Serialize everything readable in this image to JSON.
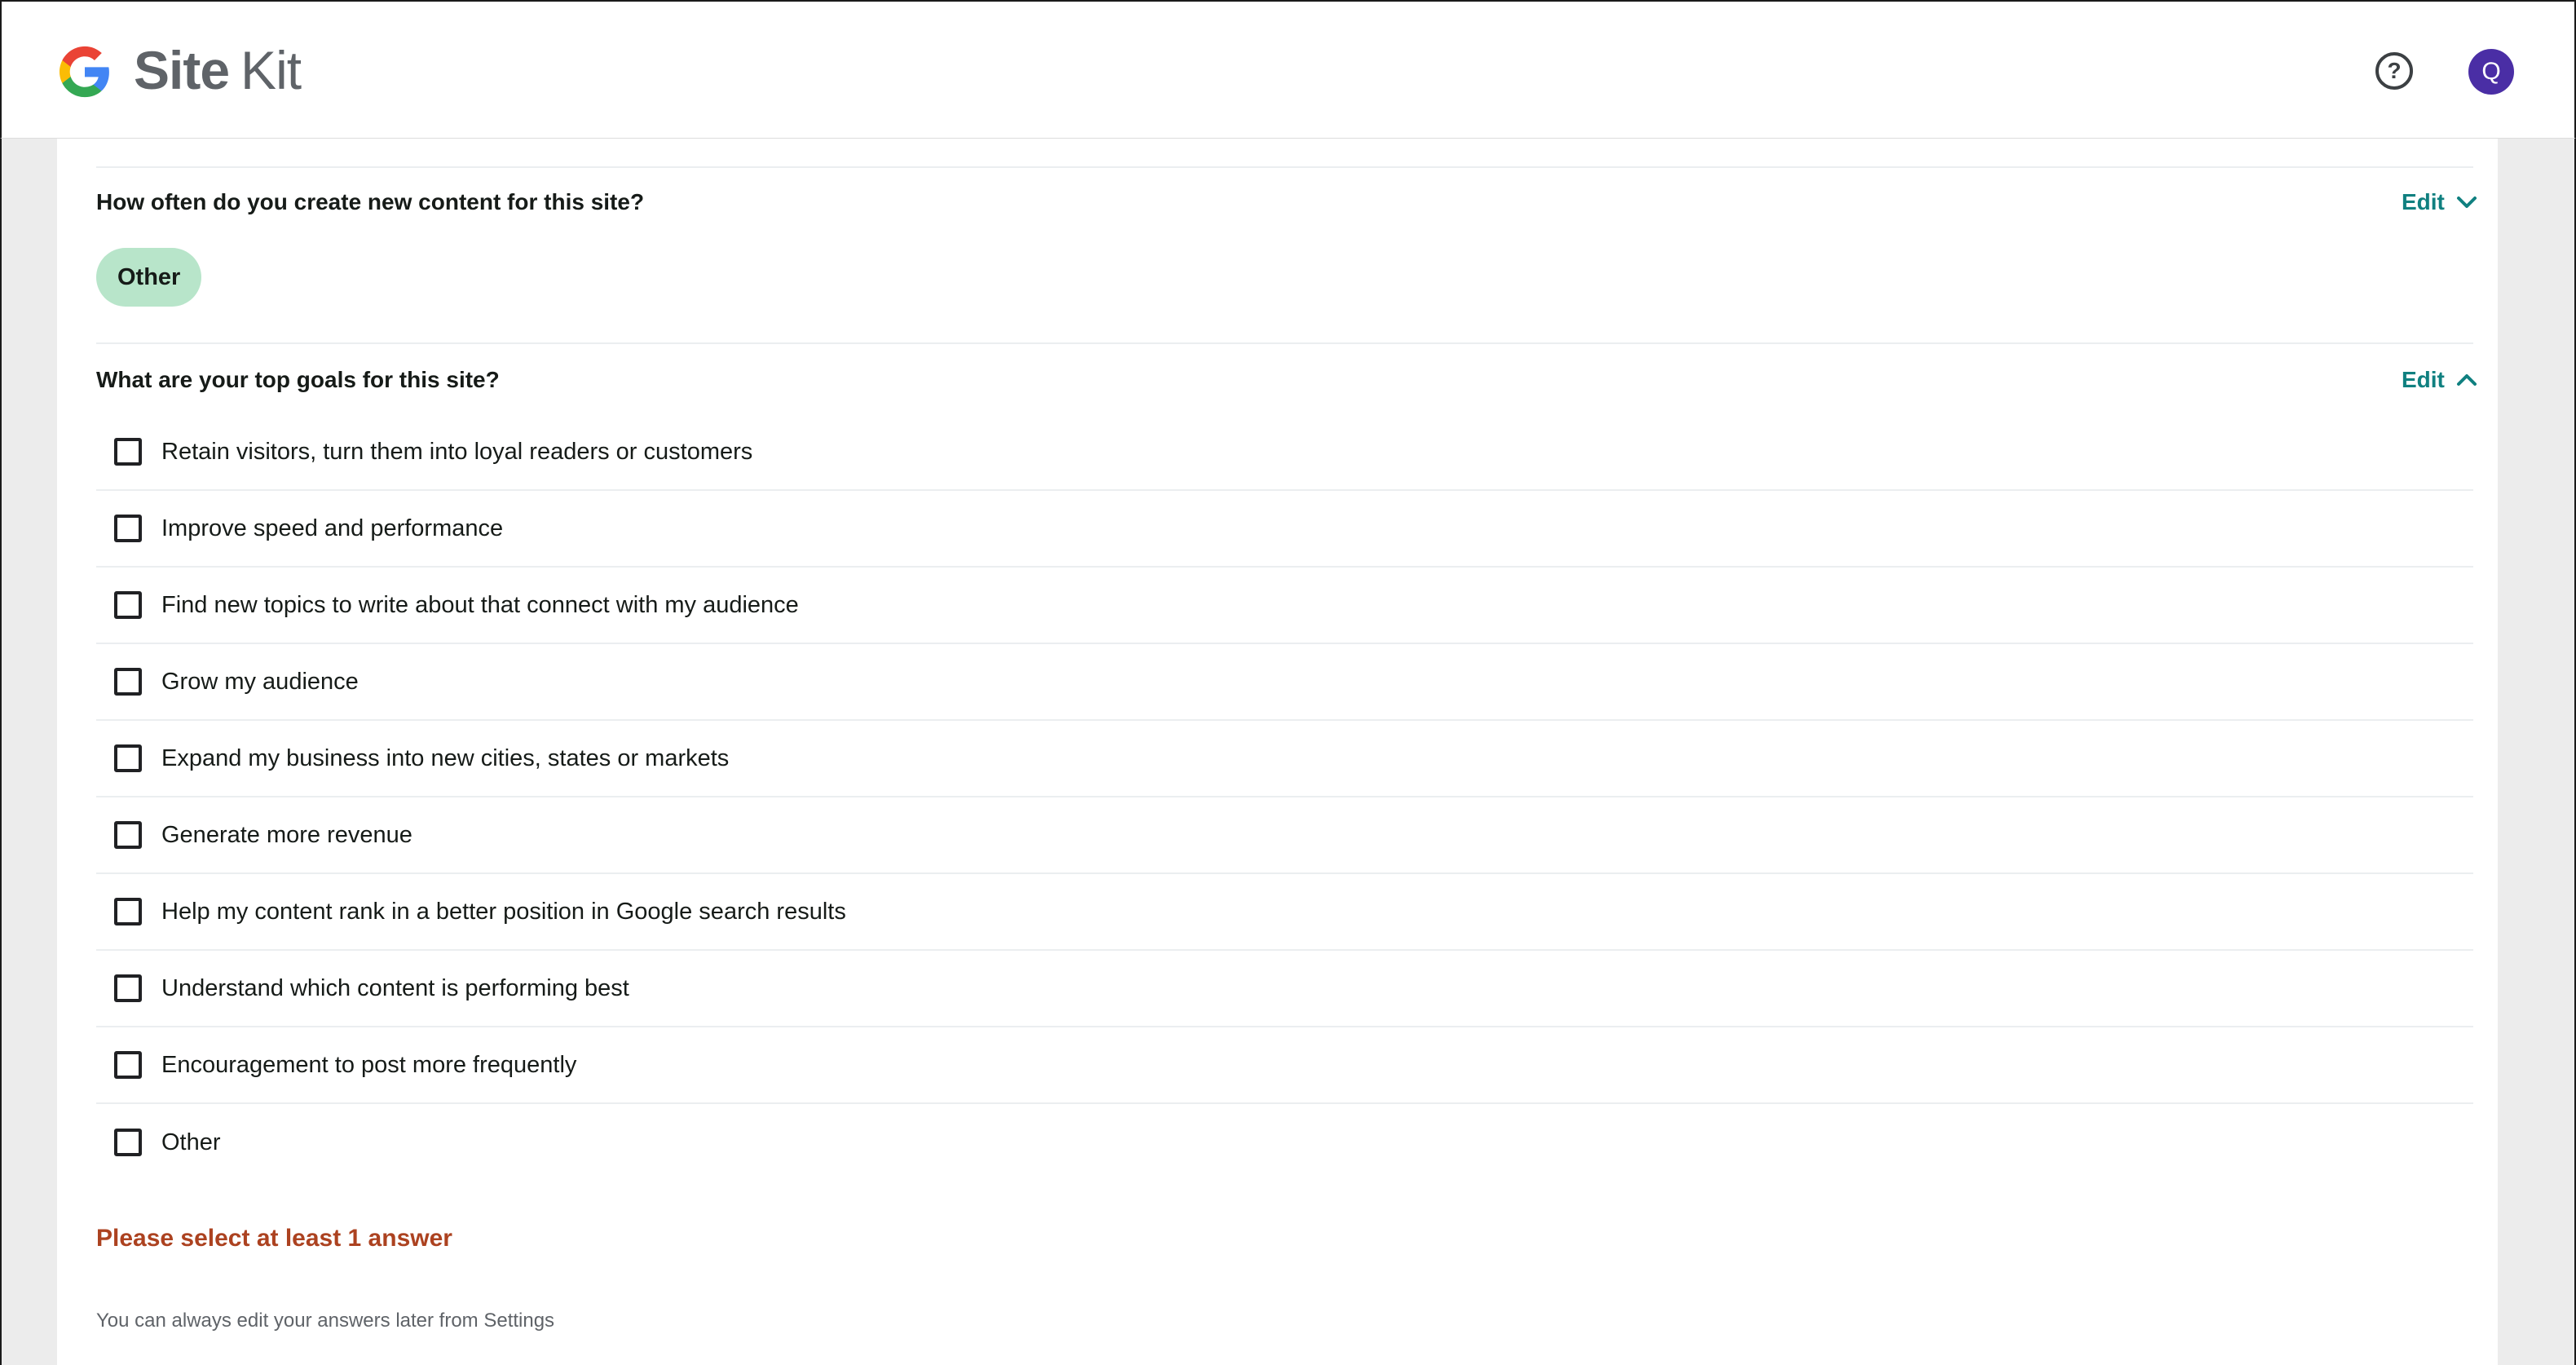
{
  "header": {
    "brand_site": "Site",
    "brand_kit": "Kit",
    "help_icon": "help-circle-icon",
    "avatar_initial": "Q",
    "avatar_color": "#4a2ea5"
  },
  "content_frequency": {
    "question": "How often do you create new content for this site?",
    "edit_label": "Edit",
    "edit_icon": "chevron-down-icon",
    "selected_answer": "Other"
  },
  "goals": {
    "question": "What are your top goals for this site?",
    "edit_label": "Edit",
    "edit_icon": "chevron-up-icon",
    "options": [
      {
        "label": "Retain visitors, turn them into loyal readers or customers",
        "checked": false
      },
      {
        "label": "Improve speed and performance",
        "checked": false
      },
      {
        "label": "Find new topics to write about that connect with my audience",
        "checked": false
      },
      {
        "label": "Grow my audience",
        "checked": false
      },
      {
        "label": "Expand my business into new cities, states or markets",
        "checked": false
      },
      {
        "label": "Generate more revenue",
        "checked": false
      },
      {
        "label": "Help my content rank in a better position in Google search results",
        "checked": false
      },
      {
        "label": "Understand which content is performing best",
        "checked": false
      },
      {
        "label": "Encouragement to post more frequently",
        "checked": false
      },
      {
        "label": "Other",
        "checked": false
      }
    ],
    "error_message": "Please select at least 1 answer",
    "footnote": "You can always edit your answers later from Settings"
  },
  "colors": {
    "accent_link": "#108080",
    "chip_background": "#b8e5ca",
    "error": "#ac4220"
  }
}
